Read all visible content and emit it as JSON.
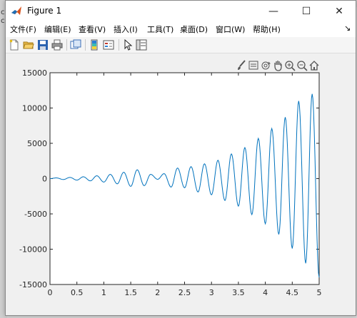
{
  "window": {
    "title": "Figure 1"
  },
  "titlebar_buttons": {
    "minimize": "—",
    "maximize": "☐",
    "close": "✕"
  },
  "menu": {
    "items": [
      "文件(F)",
      "编辑(E)",
      "查看(V)",
      "插入(I)",
      "工具(T)",
      "桌面(D)",
      "窗口(W)",
      "帮助(H)"
    ],
    "overflow": "↘"
  },
  "toolbar_icons": [
    "new-figure-icon",
    "open-file-icon",
    "save-icon",
    "print-icon",
    "link-plot-icon",
    "insert-colorbar-icon",
    "insert-legend-icon",
    "select-arrow-icon",
    "property-inspector-icon"
  ],
  "axes_toolbar_icons": [
    "brush-icon",
    "data-tips-icon",
    "rotate-3d-icon",
    "pan-hand-icon",
    "zoom-in-icon",
    "zoom-out-icon",
    "home-icon"
  ],
  "background_letters": [
    "c",
    "c"
  ],
  "chart_data": {
    "type": "line",
    "title": "",
    "xlabel": "",
    "ylabel": "",
    "xlim": [
      0,
      5
    ],
    "ylim": [
      -15000,
      15000
    ],
    "xticks": [
      "0",
      "0.5",
      "1",
      "1.5",
      "2",
      "2.5",
      "3",
      "3.5",
      "4",
      "4.5",
      "5"
    ],
    "yticks": [
      "15000",
      "10000",
      "5000",
      "0",
      "-5000",
      "-10000",
      "-15000"
    ],
    "grid": false,
    "line_color": "#0072bd",
    "series": [
      {
        "formula": "y = 100*e^(x) * sin(4*pi*x) approx; oscillation ~2 cycles per unit, amplitude growing to ~12000 near x=4.8 and ~-14000 near x=4.95",
        "x": [
          0.0,
          0.12,
          0.25,
          0.37,
          0.5,
          0.62,
          0.75,
          0.87,
          1.0,
          1.12,
          1.25,
          1.37,
          1.5,
          1.62,
          1.75,
          1.87,
          2.0,
          2.12,
          2.25,
          2.37,
          2.5,
          2.62,
          2.75,
          2.87,
          3.0,
          3.12,
          3.25,
          3.37,
          3.5,
          3.62,
          3.75,
          3.87,
          4.0,
          4.12,
          4.25,
          4.37,
          4.5,
          4.62,
          4.75,
          4.87,
          5.0
        ],
        "y": [
          0,
          100,
          -130,
          170,
          -210,
          260,
          -320,
          400,
          -490,
          600,
          -740,
          900,
          -1100,
          1250,
          -1000,
          600,
          -100,
          700,
          -1200,
          1500,
          -1300,
          1700,
          -1900,
          2100,
          -2300,
          2600,
          -3100,
          3500,
          -3900,
          4400,
          -5100,
          5700,
          -6400,
          7100,
          -7900,
          8700,
          -9900,
          11000,
          -12000,
          12000,
          -14000
        ]
      }
    ]
  }
}
